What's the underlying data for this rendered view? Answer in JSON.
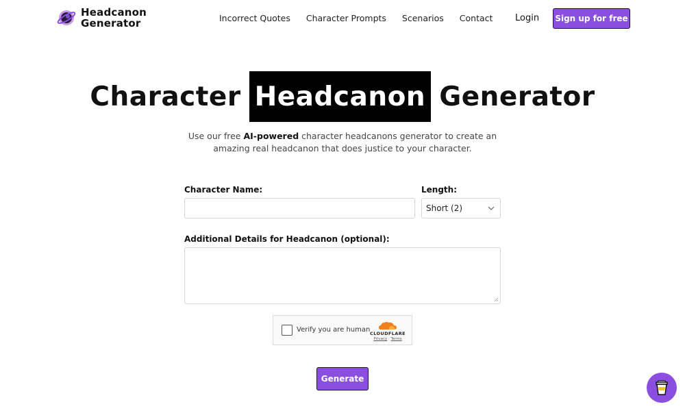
{
  "header": {
    "logo_line1": "Headcanon",
    "logo_line2": "Generator",
    "nav": [
      "Incorrect Quotes",
      "Character Prompts",
      "Scenarios",
      "Contact"
    ],
    "login_label": "Login",
    "signup_label": "Sign up for free"
  },
  "hero": {
    "title_pre": "Character",
    "title_highlight": "Headcanon",
    "title_post": "Generator",
    "subtitle_pre": "Use our free ",
    "subtitle_bold": "AI-powered",
    "subtitle_post": " character headcanons generator to create an amazing real headcanon that does justice to your character."
  },
  "form": {
    "name_label": "Character Name:",
    "name_value": "",
    "length_label": "Length:",
    "length_value": "Short (2)",
    "details_label": "Additional Details for Headcanon (optional):",
    "details_value": "",
    "captcha_text": "Verify you are human",
    "captcha_brand": "CLOUDFLARE",
    "captcha_privacy": "Privacy",
    "captcha_terms": "Terms",
    "generate_label": "Generate"
  },
  "colors": {
    "accent": "#8a4fe0",
    "highlight_bg": "#000000",
    "cloudflare_orange": "#f38020"
  },
  "icons": {
    "logo": "planet-eye-icon",
    "select": "chevron-down-icon",
    "captcha": "cloudflare-cloud-icon",
    "floating": "coffee-cup-icon"
  }
}
